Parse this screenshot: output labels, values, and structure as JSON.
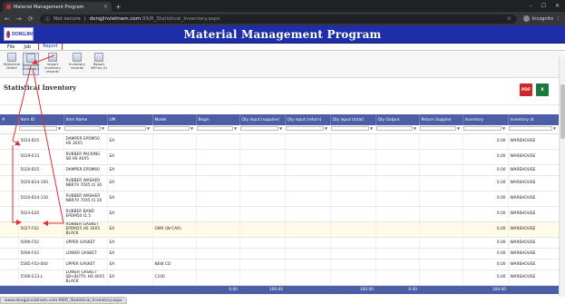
{
  "browser": {
    "tab_title": "Material Management Program",
    "new_tab": "+",
    "not_secure": "Not secure",
    "url_host": "dongjinvietnam.com",
    "url_path": ":99/R_Statistical_Inventory.aspx",
    "profile": "Incognito"
  },
  "app": {
    "logo_text": "DONGJIN",
    "title": "Material Management Program"
  },
  "menu": [
    "File",
    "Job",
    "Report"
  ],
  "menu_active": "Report",
  "ribbon": [
    {
      "label": "Statistical Detail"
    },
    {
      "label": "Statistical Inventory"
    },
    {
      "label": "Import inventory records"
    },
    {
      "label": "Inventory records"
    },
    {
      "label": "Report WH as (t)"
    }
  ],
  "section": {
    "title": "Statistical Inventory",
    "pdf_label": "PDF",
    "xls_label": "X"
  },
  "columns": [
    "#",
    "Item ID",
    "Item Name",
    "UM",
    "Model",
    "Begin",
    "Qty input (supplier)",
    "Qty input (return)",
    "Qty input (total)",
    "Qty Output",
    "Return Supplier",
    "Inventory",
    "Inventory at"
  ],
  "rows": [
    {
      "id": "5014-B15",
      "name": "DAMPER EPDM50 HS 30X5",
      "um": "EA",
      "model": "",
      "inv": "0.00",
      "at": "WAREHOUSE"
    },
    {
      "id": "5019-E13",
      "name": "RUBBER PACKING SB HS 40X5",
      "um": "EA",
      "model": "",
      "inv": "0.00",
      "at": "WAREHOUSE"
    },
    {
      "id": "5020-B15",
      "name": "DAMPER EPDM60",
      "um": "EA",
      "model": "",
      "inv": "0.00",
      "at": "WAREHOUSE"
    },
    {
      "id": "5020-B14-100",
      "name": "RUBBER WASHER NBR70 70X5 t1.30",
      "um": "EA",
      "model": "",
      "inv": "0.00",
      "at": "WAREHOUSE"
    },
    {
      "id": "5020-B14-130",
      "name": "RUBBER WASHER NBR70 70X5 t1.30",
      "um": "EA",
      "model": "",
      "inv": "0.00",
      "at": "WAREHOUSE"
    },
    {
      "id": "5023-E20",
      "name": "RUBBER BAND EPDM50 t1.5",
      "um": "EA",
      "model": "",
      "inv": "0.00",
      "at": "WAREHOUSE"
    },
    {
      "id": "5027-F02",
      "name": "RUBBER GASKET EPDM25 HS 30X5 BLACK",
      "um": "EA",
      "model": "GMX (W-CAR)",
      "inv": "0.00",
      "at": "WAREHOUSE"
    },
    {
      "id": "5090-F02",
      "name": "UPPER GASKET",
      "um": "EA",
      "model": "",
      "inv": "0.00",
      "at": "WAREHOUSE"
    },
    {
      "id": "5090-F03",
      "name": "LOWER GASKET",
      "um": "EA",
      "model": "",
      "inv": "0.00",
      "at": "WAREHOUSE"
    },
    {
      "id": "5585-F02-000",
      "name": "UPPER GASKET",
      "um": "EA",
      "model": "NEW CD",
      "inv": "0.00",
      "at": "WAREHOUSE"
    },
    {
      "id": "5590-E13-L",
      "name": "LOWER GASKET SB+BUTYL HS 40X5 BLACK",
      "um": "EA",
      "model": "C100",
      "inv": "0.00",
      "at": "WAREHOUSE"
    }
  ],
  "totals": {
    "begin": "0.00",
    "supplier": "100.00",
    "total": "100.00",
    "output": "0.00",
    "inventory": "100.00"
  },
  "status_url": "www.dongjinvietnam.com:99/R_Statistical_Inventory.aspx",
  "colors": {
    "header_blue": "#1e2ea8",
    "grid_header": "#4c5fa6",
    "annotation_red": "#e03030"
  }
}
